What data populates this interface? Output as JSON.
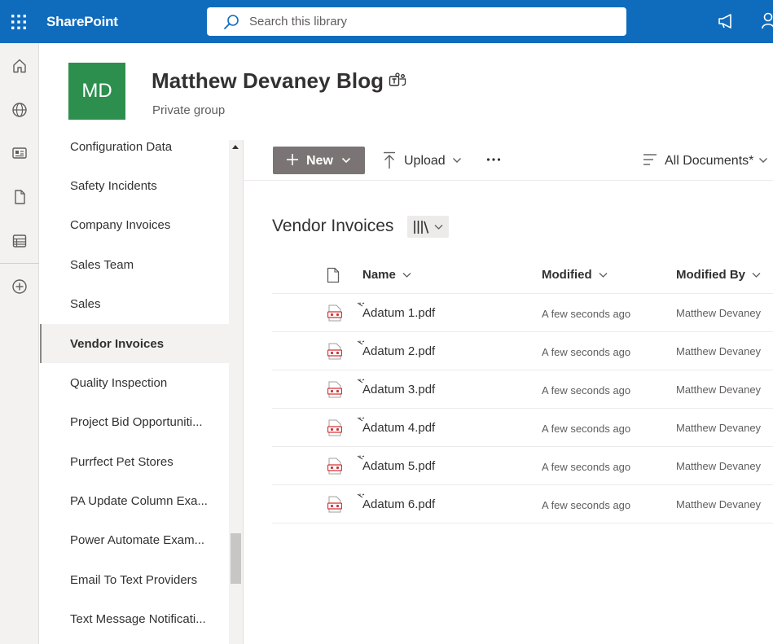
{
  "suite": {
    "brand": "SharePoint",
    "search_placeholder": "Search this library"
  },
  "site": {
    "logo_initials": "MD",
    "title": "Matthew Devaney Blog",
    "subtitle": "Private group",
    "logo_color": "#2d8f4e"
  },
  "nav": {
    "items": [
      {
        "label": "Configuration Data"
      },
      {
        "label": "Safety Incidents"
      },
      {
        "label": "Company Invoices"
      },
      {
        "label": "Sales Team"
      },
      {
        "label": "Sales"
      },
      {
        "label": "Vendor Invoices"
      },
      {
        "label": "Quality Inspection"
      },
      {
        "label": "Project Bid Opportuniti..."
      },
      {
        "label": "Purrfect Pet Stores"
      },
      {
        "label": "PA Update Column Exa..."
      },
      {
        "label": "Power Automate Exam..."
      },
      {
        "label": "Email To Text Providers"
      },
      {
        "label": "Text Message Notificati..."
      }
    ],
    "selected": "Vendor Invoices"
  },
  "commandbar": {
    "new_label": "New",
    "upload_label": "Upload",
    "view_label": "All Documents*"
  },
  "library": {
    "title": "Vendor Invoices",
    "columns": {
      "name": "Name",
      "modified": "Modified",
      "modified_by": "Modified By"
    },
    "rows": [
      {
        "name": "Adatum 1.pdf",
        "modified": "A few seconds ago",
        "modified_by": "Matthew Devaney"
      },
      {
        "name": "Adatum 2.pdf",
        "modified": "A few seconds ago",
        "modified_by": "Matthew Devaney"
      },
      {
        "name": "Adatum 3.pdf",
        "modified": "A few seconds ago",
        "modified_by": "Matthew Devaney"
      },
      {
        "name": "Adatum 4.pdf",
        "modified": "A few seconds ago",
        "modified_by": "Matthew Devaney"
      },
      {
        "name": "Adatum 5.pdf",
        "modified": "A few seconds ago",
        "modified_by": "Matthew Devaney"
      },
      {
        "name": "Adatum 6.pdf",
        "modified": "A few seconds ago",
        "modified_by": "Matthew Devaney"
      }
    ]
  },
  "colors": {
    "suite_bar": "#0f6cbd",
    "new_button": "#7a7574",
    "pdf_icon": "#d13438"
  },
  "icons": {
    "waffle": "waffle-icon",
    "search": "search-icon",
    "teams": "teams-icon",
    "file_type": "pdf-icon",
    "new_item": "new-item-sparkle-icon"
  }
}
